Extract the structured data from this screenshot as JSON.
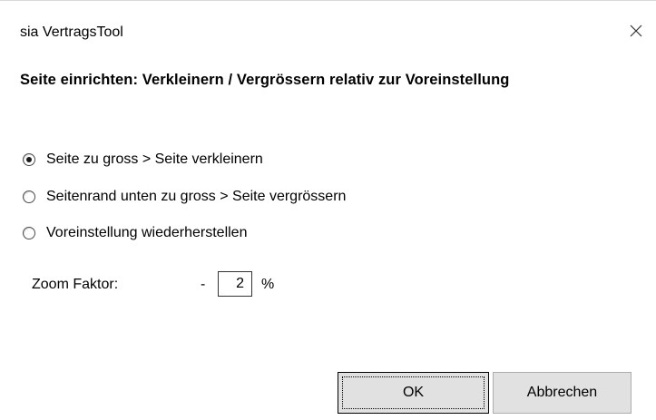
{
  "window": {
    "title": "sia VertragsTool"
  },
  "heading": "Seite einrichten: Verkleinern / Vergrössern relativ zur Voreinstellung",
  "options": [
    {
      "label": "Seite zu gross > Seite verkleinern",
      "checked": true
    },
    {
      "label": "Seitenrand unten zu gross > Seite vergrössern",
      "checked": false
    },
    {
      "label": "Voreinstellung wiederherstellen",
      "checked": false
    }
  ],
  "zoom": {
    "label": "Zoom Faktor:",
    "sign": "-",
    "value": "2",
    "unit": "%"
  },
  "buttons": {
    "ok": "OK",
    "cancel": "Abbrechen"
  },
  "icons": {
    "close": "close-icon"
  }
}
